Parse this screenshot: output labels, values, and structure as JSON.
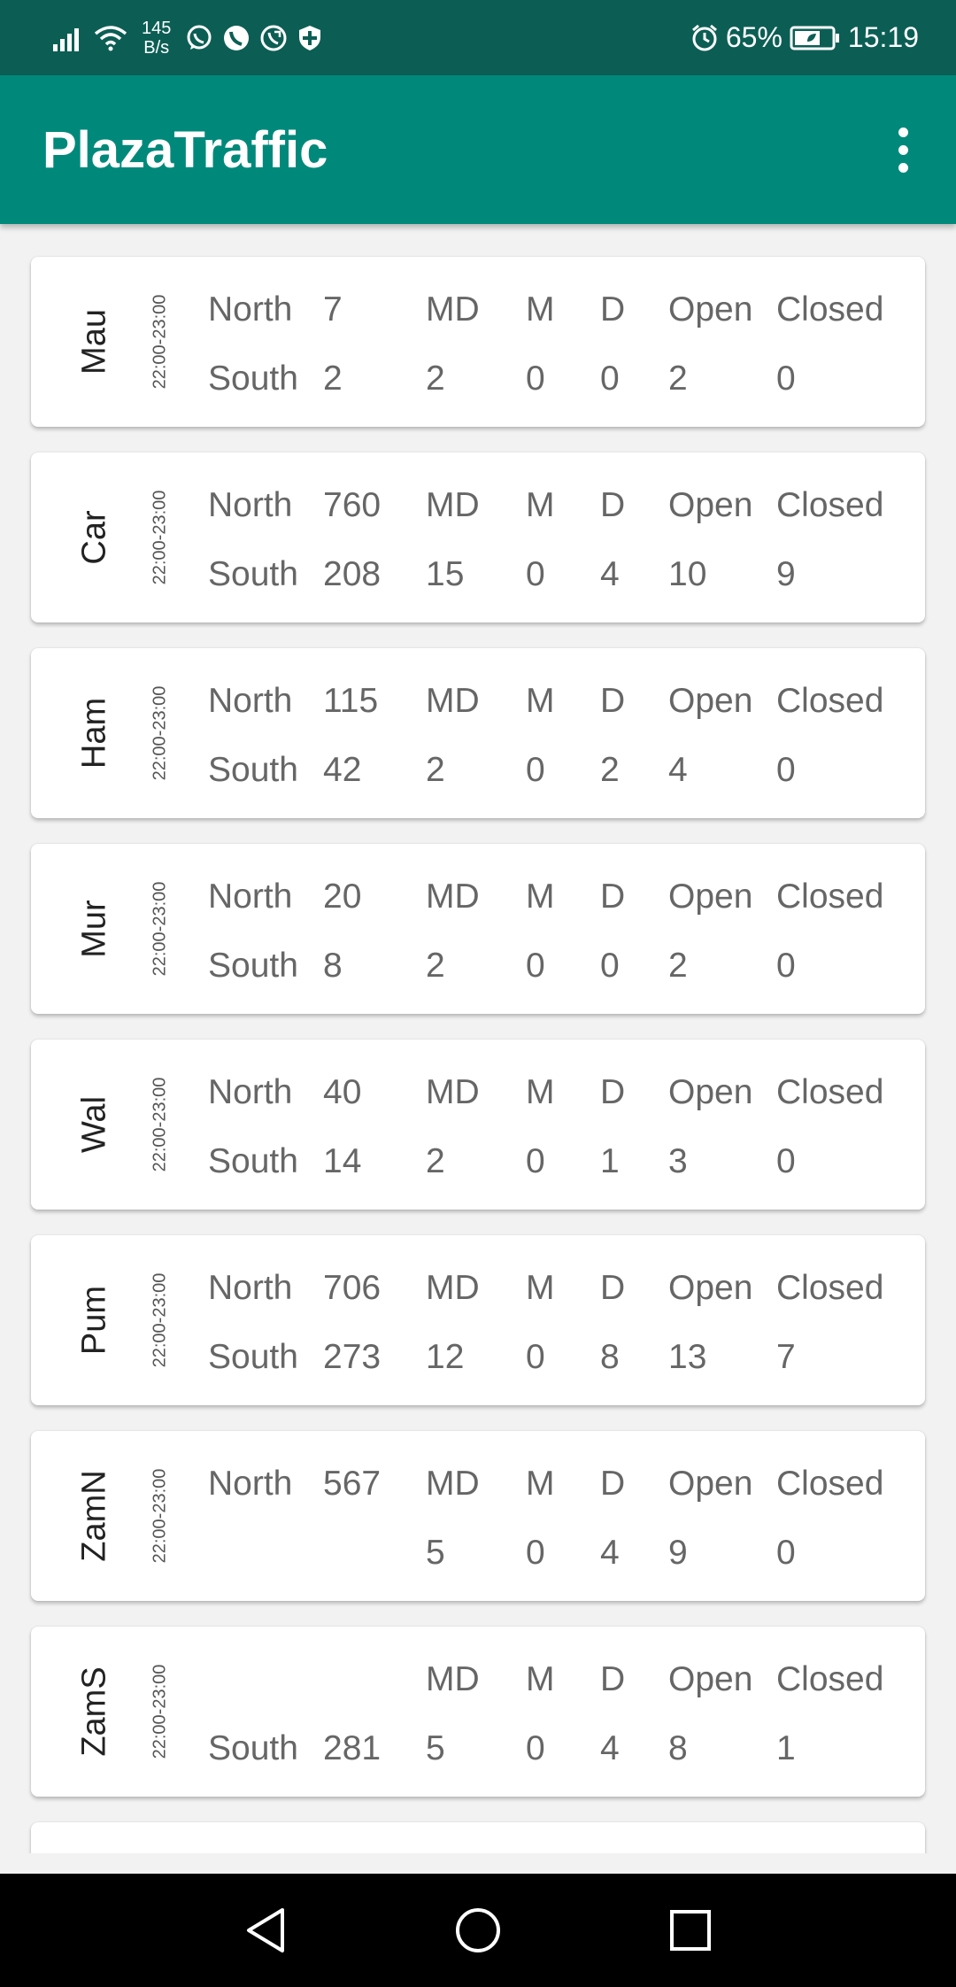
{
  "status_bar": {
    "net_speed_value": "145",
    "net_speed_unit": "B/s",
    "battery": "65%",
    "time": "15:19",
    "icons": [
      "signal-icon",
      "wifi-icon",
      "whatsapp-icon",
      "phone-icon",
      "call-icon",
      "shield-icon",
      "alarm-icon",
      "battery-icon"
    ]
  },
  "app_bar": {
    "title": "PlazaTraffic",
    "menu_icon": "more-vert-icon"
  },
  "colors": {
    "status_bar": "#0c5e55",
    "app_bar": "#00897b",
    "background": "#f2f2f2",
    "card": "#ffffff",
    "text": "#666666"
  },
  "plazas": [
    {
      "name": "Mau",
      "time": "22:00-23:00",
      "row1": {
        "dir": "North",
        "count": "7",
        "md": "MD",
        "m": "M",
        "d": "D",
        "open": "Open",
        "closed": "Closed"
      },
      "row2": {
        "dir": "South",
        "count": "2",
        "md": "2",
        "m": "0",
        "d": "0",
        "open": "2",
        "closed": "0"
      }
    },
    {
      "name": "Car",
      "time": "22:00-23:00",
      "row1": {
        "dir": "North",
        "count": "760",
        "md": "MD",
        "m": "M",
        "d": "D",
        "open": "Open",
        "closed": "Closed"
      },
      "row2": {
        "dir": "South",
        "count": "208",
        "md": "15",
        "m": "0",
        "d": "4",
        "open": "10",
        "closed": "9"
      }
    },
    {
      "name": "Ham",
      "time": "22:00-23:00",
      "row1": {
        "dir": "North",
        "count": "115",
        "md": "MD",
        "m": "M",
        "d": "D",
        "open": "Open",
        "closed": "Closed"
      },
      "row2": {
        "dir": "South",
        "count": "42",
        "md": "2",
        "m": "0",
        "d": "2",
        "open": "4",
        "closed": "0"
      }
    },
    {
      "name": "Mur",
      "time": "22:00-23:00",
      "row1": {
        "dir": "North",
        "count": "20",
        "md": "MD",
        "m": "M",
        "d": "D",
        "open": "Open",
        "closed": "Closed"
      },
      "row2": {
        "dir": "South",
        "count": "8",
        "md": "2",
        "m": "0",
        "d": "0",
        "open": "2",
        "closed": "0"
      }
    },
    {
      "name": "Wal",
      "time": "22:00-23:00",
      "row1": {
        "dir": "North",
        "count": "40",
        "md": "MD",
        "m": "M",
        "d": "D",
        "open": "Open",
        "closed": "Closed"
      },
      "row2": {
        "dir": "South",
        "count": "14",
        "md": "2",
        "m": "0",
        "d": "1",
        "open": "3",
        "closed": "0"
      }
    },
    {
      "name": "Pum",
      "time": "22:00-23:00",
      "row1": {
        "dir": "North",
        "count": "706",
        "md": "MD",
        "m": "M",
        "d": "D",
        "open": "Open",
        "closed": "Closed"
      },
      "row2": {
        "dir": "South",
        "count": "273",
        "md": "12",
        "m": "0",
        "d": "8",
        "open": "13",
        "closed": "7"
      }
    },
    {
      "name": "ZamN",
      "time": "22:00-23:00",
      "row1": {
        "dir": "North",
        "count": "567",
        "md": "MD",
        "m": "M",
        "d": "D",
        "open": "Open",
        "closed": "Closed"
      },
      "row2": {
        "dir": "",
        "count": "",
        "md": "5",
        "m": "0",
        "d": "4",
        "open": "9",
        "closed": "0"
      }
    },
    {
      "name": "ZamS",
      "time": "22:00-23:00",
      "row1": {
        "dir": "",
        "count": "",
        "md": "MD",
        "m": "M",
        "d": "D",
        "open": "Open",
        "closed": "Closed"
      },
      "row2": {
        "dir": "South",
        "count": "281",
        "md": "5",
        "m": "0",
        "d": "4",
        "open": "8",
        "closed": "1"
      }
    }
  ],
  "nav_bar": {
    "buttons": [
      "back-icon",
      "home-icon",
      "recents-icon"
    ]
  }
}
